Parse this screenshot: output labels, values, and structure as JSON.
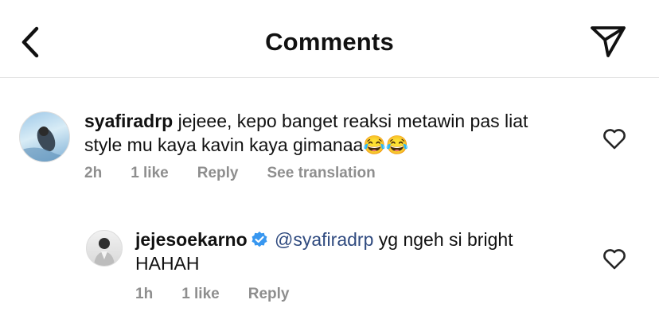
{
  "header": {
    "title": "Comments"
  },
  "comments": [
    {
      "username": "syafiradrp",
      "text": "jejeee, kepo banget reaksi metawin pas liat style mu kaya kavin kaya gimanaa",
      "emojis": "😂😂",
      "time": "2h",
      "likes": "1 like",
      "reply": "Reply",
      "translate": "See translation"
    },
    {
      "username": "jejesoekarno",
      "verified": true,
      "mention": "@syafiradrp",
      "text": "yg ngeh si bright HAHAH",
      "time": "1h",
      "likes": "1 like",
      "reply": "Reply"
    }
  ],
  "icons": [
    "back-arrow-icon",
    "send-icon",
    "heart-icon",
    "verified-badge-icon"
  ],
  "colors": {
    "mention": "#2f4a7f",
    "verified": "#3897f0",
    "meta": "#8e8e8e"
  }
}
